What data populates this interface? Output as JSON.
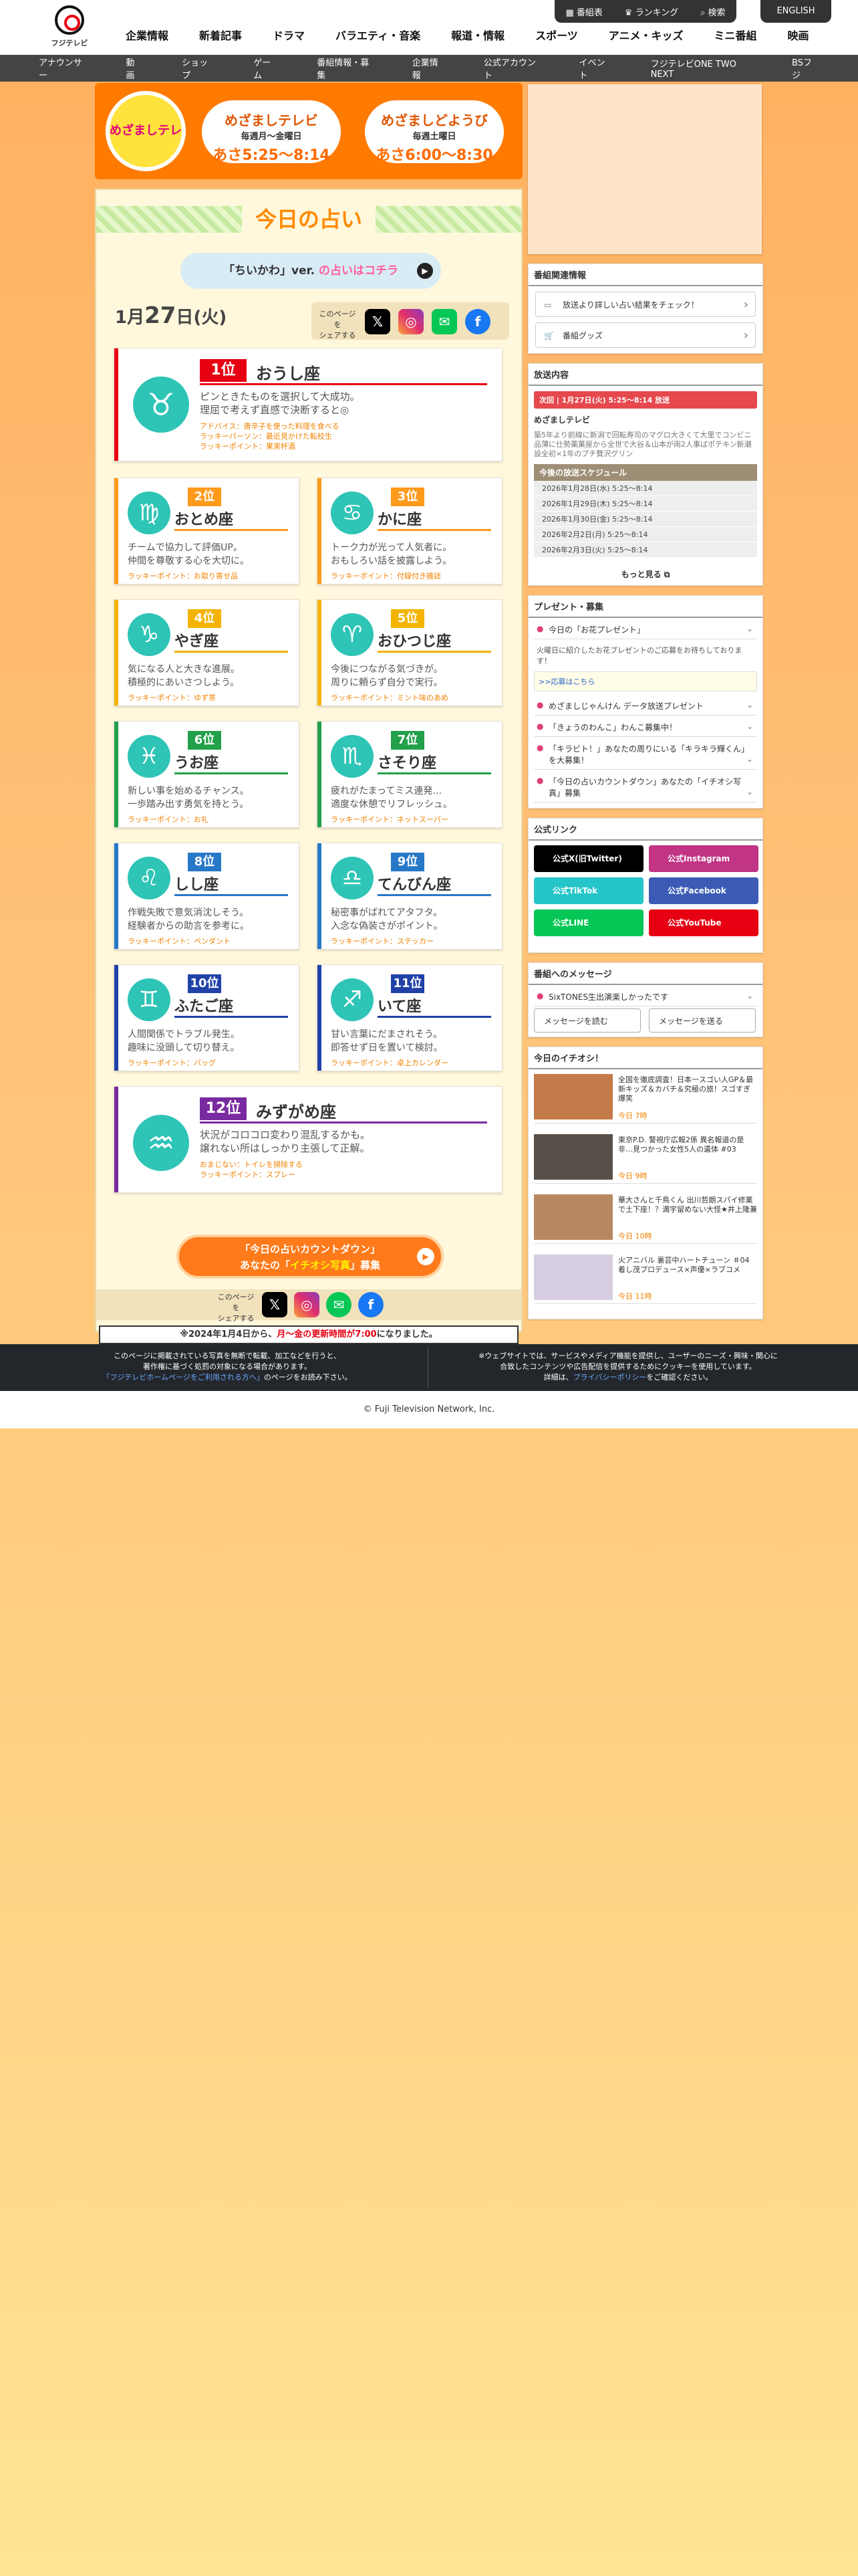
{
  "header": {
    "logo_text": "フジテレビ",
    "nav": [
      "企業情報",
      "新着記事",
      "ドラマ",
      "バラエティ・音楽",
      "報道・情報",
      "スポーツ",
      "アニメ・キッズ",
      "ミニ番組",
      "映画"
    ],
    "top_buttons": [
      "番組表",
      "ランキング",
      "検索"
    ],
    "english": "ENGLISH"
  },
  "subnav": [
    "アナウンサー",
    "動画",
    "ショップ",
    "ゲーム",
    "番組情報・募集",
    "企業情報",
    "公式アカウント",
    "イベント",
    "フジテレビONE TWO NEXT",
    "BSフジ"
  ],
  "banner": {
    "logo": "めざましテレビ",
    "p1": {
      "title": "めざましテレビ",
      "days": "毎週月〜金曜日",
      "time": "あさ5:25〜8:14"
    },
    "p2": {
      "title": "めざましどようび",
      "days": "毎週土曜日",
      "time": "あさ6:00〜8:30"
    }
  },
  "fortune": {
    "title": "今日の占い",
    "chiikawa_a": "「ちいかわ」ver.",
    "chiikawa_b": "の占いはコチラ",
    "date_month": "1月",
    "date_day": "27",
    "date_unit": "日",
    "weekday": "(火)",
    "share_label": "このページを\nシェアする"
  },
  "signs": [
    {
      "rank": "1位",
      "name": "おうし座",
      "glyph": "♉",
      "desc": "ピンときたものを選択して大成功。\n理屈で考えず直感で決断すると◎",
      "advice": "アドバイス：唐辛子を使った料理を食べる",
      "person": "ラッキーパーソン：最近見かけた転校生",
      "point": "ラッキーポイント：果実杯酒"
    },
    {
      "rank": "2位",
      "name": "おとめ座",
      "glyph": "♍",
      "desc": "チームで協力して評価UP。\n仲間を尊敬する心を大切に。",
      "point": "ラッキーポイント：お取り寄せ品"
    },
    {
      "rank": "3位",
      "name": "かに座",
      "glyph": "♋",
      "desc": "トーク力が光って人気者に。\nおもしろい話を披露しよう。",
      "point": "ラッキーポイント：付録付き雑誌"
    },
    {
      "rank": "4位",
      "name": "やぎ座",
      "glyph": "♑",
      "desc": "気になる人と大きな進展。\n積極的にあいさつしよう。",
      "point": "ラッキーポイント：ゆず茶"
    },
    {
      "rank": "5位",
      "name": "おひつじ座",
      "glyph": "♈",
      "desc": "今後につながる気づきが。\n周りに頼らず自分で実行。",
      "point": "ラッキーポイント：ミント味のあめ"
    },
    {
      "rank": "6位",
      "name": "うお座",
      "glyph": "♓",
      "desc": "新しい事を始めるチャンス。\n一歩踏み出す勇気を持とう。",
      "point": "ラッキーポイント：お礼"
    },
    {
      "rank": "7位",
      "name": "さそり座",
      "glyph": "♏",
      "desc": "疲れがたまってミス連発…\n適度な休憩でリフレッシュ。",
      "point": "ラッキーポイント：ネットスーパー"
    },
    {
      "rank": "8位",
      "name": "しし座",
      "glyph": "♌",
      "desc": "作戦失敗で意気消沈しそう。\n経験者からの助言を参考に。",
      "point": "ラッキーポイント：ペンダント"
    },
    {
      "rank": "9位",
      "name": "てんびん座",
      "glyph": "♎",
      "desc": "秘密事がばれてアタフタ。\n入念な偽装さがポイント。",
      "point": "ラッキーポイント：ステッカー"
    },
    {
      "rank": "10位",
      "name": "ふたご座",
      "glyph": "♊",
      "desc": "人間関係でトラブル発生。\n趣味に没頭して切り替え。",
      "point": "ラッキーポイント：バッグ"
    },
    {
      "rank": "11位",
      "name": "いて座",
      "glyph": "♐",
      "desc": "甘い言葉にだまされそう。\n即答せず日を置いて検討。",
      "point": "ラッキーポイント：卓上カレンダー"
    },
    {
      "rank": "12位",
      "name": "みずがめ座",
      "glyph": "♒",
      "desc": "状況がコロコロ変わり混乱するかも。\n譲れない所はしっかり主張して正解。",
      "advice": "おまじない：トイレを掃除する",
      "point": "ラッキーポイント：スプレー"
    }
  ],
  "cta": {
    "l1": "「今日の占いカウントダウン」",
    "l2a": "あなたの「",
    "l2b": "イチオシ写真",
    "l2c": "」募集"
  },
  "notice": {
    "a": "※2024年1月4日から、",
    "b": "月〜金の更新時間が7:00",
    "c": "になりました。"
  },
  "side": {
    "related": {
      "h": "番組関連情報",
      "items": [
        "放送より詳しい占い結果をチェック！",
        "番組グッズ"
      ]
    },
    "broadcast": {
      "h": "放送内容",
      "next": "次回 | 1月27日(火) 5:25〜8:14 放送",
      "name": "めざましテレビ",
      "desc": "築5年より前線に新潟で回転寿司のマグロ大きくて大里でコンビニ品薄に仕勢薬菓屋から全世で大谷＆山本が両2人事ばポテキン新潮設全初×1年のプチ贅沢グリン",
      "sched_h": "今後の放送スケジュール",
      "sched": [
        "2026年1月28日(水) 5:25〜8:14",
        "2026年1月29日(木) 5:25〜8:14",
        "2026年1月30日(金) 5:25〜8:14",
        "2026年2月2日(月) 5:25〜8:14",
        "2026年2月3日(火) 5:25〜8:14"
      ],
      "more": "もっと見る"
    },
    "present": {
      "h": "プレゼント・募集",
      "items": [
        "今日の「お花プレゼント」",
        "めざましじゃんけん データ放送プレゼント",
        "「きょうのわんこ」わんこ募集中！",
        "「キラビト！」あなたの周りにいる「キラキラ輝くん」を大募集！",
        "「今日の占いカウントダウン」あなたの「イチオシ写真」募集"
      ],
      "body": "火曜日に紹介したお花プレゼントのご応募をお待ちしております！",
      "link": ">>応募はこちら"
    },
    "official": {
      "h": "公式リンク",
      "items": [
        "公式X(旧Twitter)",
        "公式Instagram",
        "公式TikTok",
        "公式Facebook",
        "公式LINE",
        "公式YouTube"
      ]
    },
    "message": {
      "h": "番組へのメッセージ",
      "topic": "SixTONES生出演楽しかったです",
      "read": "メッセージを読む",
      "send": "メッセージを送る"
    },
    "ichioshi": {
      "h": "今日のイチオシ！",
      "items": [
        {
          "t": "全国を徹底調査！日本一スゴい人GP＆最新キッズ＆カバチ＆究極の旅！スゴすぎ爆笑",
          "d": "今日 7時"
        },
        {
          "t": "東京P.D. 警視庁広報2係 異名報道の是非…見つかった女性5人の遺体 #03",
          "d": "今日 9時"
        },
        {
          "t": "華大さんと千鳥くん 出川哲朗スパイ修業で土下座！？満宇留めない大怪★井上隆兼",
          "d": "今日 10時"
        },
        {
          "t": "火アニバル 裏芸中ハートチューン ＃04 着し茂プロデュース×声優×ラブコメ",
          "d": "今日 11時"
        }
      ]
    }
  },
  "footer": {
    "l1": "このページに掲載されている写真を無断で転載、加工などを行うと、",
    "l2": "著作権に基づく処罰の対象になる場合があります。",
    "l3a": "「フジテレビホームページをご利用される方へ」",
    "l3b": "のページをお読み下さい。",
    "r1": "※ウェブサイトでは、サービスやメディア機能を提供し、ユーザーのニーズ・興味・関心に",
    "r2": "合致したコンテンツや広告配信を提供するためにクッキーを使用しています。",
    "r3a": "詳細は、",
    "r3b": "プライバシーポリシー",
    "r3c": "をご確認ください。"
  },
  "copyright": "© Fuji Television Network, Inc."
}
